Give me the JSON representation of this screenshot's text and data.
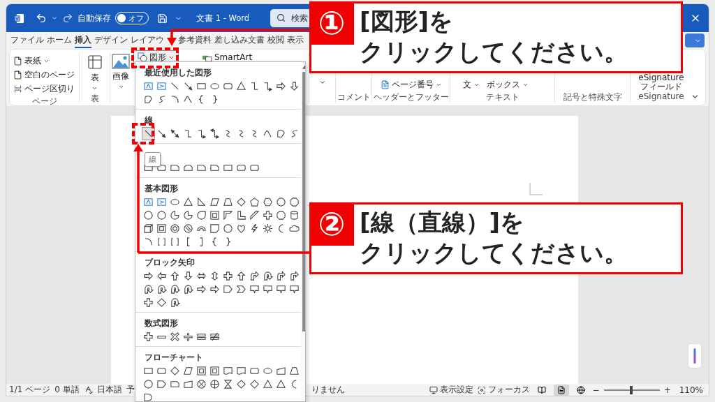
{
  "title_bar": {
    "autosave_label": "自動保存",
    "autosave": {
      "label": "オフ",
      "on": false
    },
    "document_title": "文書 1 - Word",
    "search": {
      "placeholder": "検索"
    }
  },
  "ribbon_tabs": [
    {
      "label": "ファイル",
      "selected": false
    },
    {
      "label": "ホーム",
      "selected": false
    },
    {
      "label": "挿入",
      "selected": true
    },
    {
      "label": "デザイン",
      "selected": false
    },
    {
      "label": "レイアウ",
      "selected": false
    },
    {
      "label": "参考資料",
      "selected": false
    },
    {
      "label": "差し込み文書",
      "selected": false
    },
    {
      "label": "校閲",
      "selected": false
    },
    {
      "label": "表示",
      "selected": false
    }
  ],
  "ribbon": {
    "page_group": {
      "buttons": [
        "表紙",
        "空白のページ",
        "ページ区切り"
      ],
      "label": "ページ"
    },
    "table_group": {
      "button": "表",
      "label": "表"
    },
    "illustrations": {
      "image_button": "画像",
      "shapes_button": {
        "label": "図形",
        "pressed": true
      },
      "smartart_button": "SmartArt"
    },
    "comment_group": {
      "label": "コメント"
    },
    "header_footer_group": {
      "page_number_button": "ページ番号",
      "label": "ヘッダーとフッター"
    },
    "text_group": {
      "greeting_button": "文",
      "textbox_button": "ボックス",
      "label": "テキスト"
    },
    "symbols_group": {
      "label": "記号と特殊文字"
    },
    "esignature_group": {
      "field_button": [
        "eSignature",
        "フィールド"
      ],
      "label": "eSignature"
    }
  },
  "shapes_menu": {
    "sections": [
      {
        "kind": "recent",
        "title": "最近使用した図形"
      },
      {
        "kind": "lines",
        "title": "線",
        "shapes": [
          {
            "selected": true
          },
          {
            "selected": false
          },
          {
            "selected": false
          },
          {
            "selected": false
          },
          {
            "selected": false
          },
          {
            "selected": false
          },
          {
            "selected": false
          },
          {
            "selected": false
          },
          {
            "selected": false
          },
          {
            "selected": false
          },
          {
            "selected": false
          },
          {
            "selected": false
          }
        ]
      },
      {
        "kind": "rectangles"
      },
      {
        "kind": "basic",
        "title": "基本図形"
      },
      {
        "kind": "block_arrows",
        "title": "ブロック矢印"
      },
      {
        "kind": "equation",
        "title": "数式図形"
      },
      {
        "kind": "flowchart",
        "title": "フローチャート"
      }
    ],
    "tooltip": "線"
  },
  "callouts": [
    {
      "number": "①",
      "lines": [
        "[図形]を",
        "クリックしてください。"
      ]
    },
    {
      "number": "②",
      "lines": [
        "[線（直線）]を",
        "クリックしてください。"
      ]
    }
  ],
  "status_bar": {
    "page": "1/1 ページ",
    "words": "0 単語",
    "language": "日本語",
    "prediction": "予",
    "accessibility": "りません",
    "display_settings": "表示設定",
    "focus": "フォーカス",
    "views": [
      {
        "selected": false
      },
      {
        "selected": true
      },
      {
        "selected": false
      }
    ],
    "zoom_out": "−",
    "zoom_in": "+",
    "zoom": {
      "level": 0.47,
      "reading": "110%"
    }
  }
}
